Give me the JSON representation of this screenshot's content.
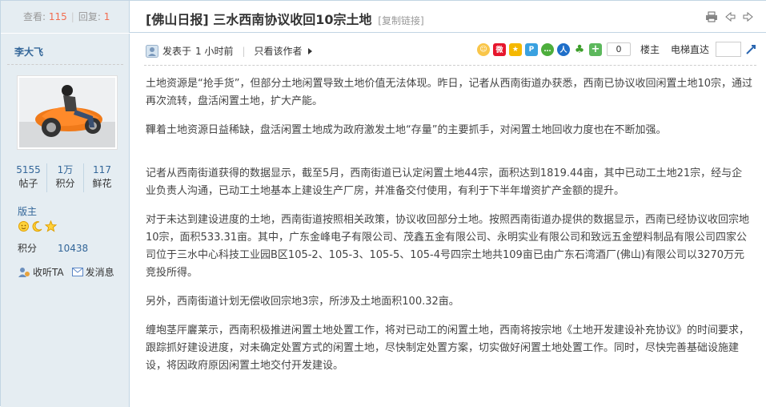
{
  "stats": {
    "views_label": "查看:",
    "views": "115",
    "replies_label": "回复:",
    "replies": "1"
  },
  "thread": {
    "title": "[佛山日报] 三水西南协议收回10宗土地",
    "copy_link": "[复制链接]"
  },
  "top_icons": [
    "print-icon",
    "prev-thread-icon",
    "next-thread-icon"
  ],
  "author": {
    "name": "李大飞",
    "posts_value": "5155",
    "posts_label": "帖子",
    "points_value": "1万",
    "points_label": "积分",
    "flowers_value": "117",
    "flowers_label": "鲜花",
    "rank": "版主",
    "credit_label": "积分",
    "credit_value": "10438",
    "follow_label": "收听TA",
    "message_label": "发消息"
  },
  "post": {
    "posted_prefix": "发表于",
    "posted_time": "1 小时前",
    "only_author": "只看该作者",
    "share_count": "0",
    "floor_label": "楼主",
    "jump_label": "电梯直达"
  },
  "share_icons": [
    "emoji-icon",
    "weibo-icon",
    "qzone-icon",
    "pengyou-icon",
    "renren-icon",
    "kaixin-icon",
    "clover-icon",
    "plus-share-icon"
  ],
  "colors": {
    "sidebar_bg": "#e5edf2",
    "border": "#c2d5e3",
    "link": "#336699",
    "count": "#f26c4f"
  },
  "paragraphs": [
    "土地资源是“抢手货”，但部分土地闲置导致土地价值无法体现。昨日，记者从西南街道办获悉，西南已协议收回闲置土地10宗，通过再次流转，盘活闲置土地，扩大产能。",
    "鞸着土地资源日益稀缺，盘活闲置土地成为政府激发土地“存量”的主要抓手，对闲置土地回收力度也在不断加强。",
    "记者从西南街道获得的数据显示，截至5月，西南街道已认定闲置土地44宗，面积达到1819.44亩，其中已动工土地21宗，经与企业负责人沟通，已动工土地基本上建设生产厂房，并准备交付使用，有利于下半年增资扩产金额的提升。",
    "对于未达到建设进度的土地，西南街道按照相关政策，协议收回部分土地。按照西南街道办提供的数据显示，西南已经协议收回宗地10宗，面积533.31亩。其中，广东金峰电子有限公司、茂鑫五金有限公司、永明实业有限公司和致远五金塑料制品有限公司四家公司位于三水中心科技工业园B区105-2、105-3、105-5、105-4号四宗土地共109亩已由广东石湾酒厂(佛山)有限公司以3270万元竞投所得。",
    "另外，西南街道计划无偿收回宗地3宗，所涉及土地面积100.32亩。",
    "缠垉茎厈廲莱示，西南积极推进闲置土地处置工作，将对已动工的闲置土地，西南将按宗地《土地开发建设补充协议》的时间要求，跟踪抓好建设进度，对未确定处置方式的闲置土地，尽快制定处置方案，切实做好闲置土地处置工作。同时，尽快完善基础设施建设，将因政府原因闲置土地交付开发建设。"
  ]
}
